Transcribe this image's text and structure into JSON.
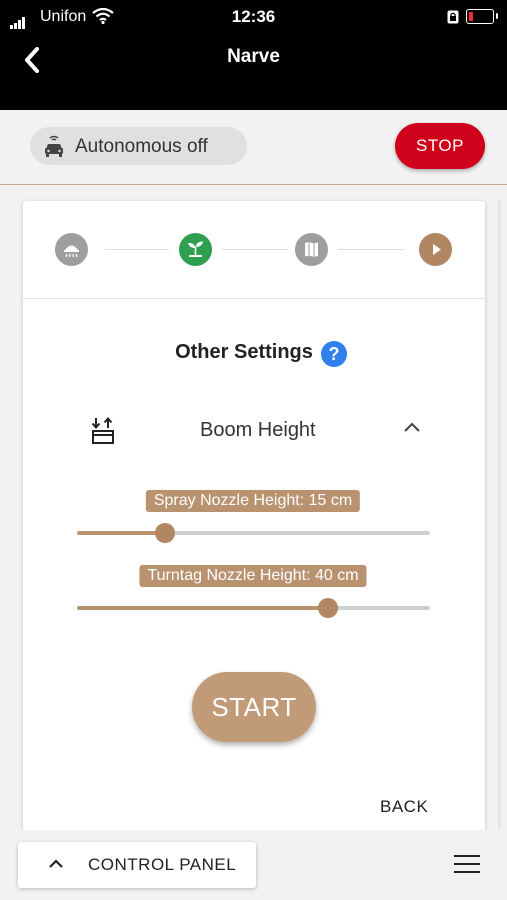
{
  "status_bar": {
    "carrier": "Unifon",
    "time": "12:36"
  },
  "nav": {
    "title": "Narve"
  },
  "autonomous": {
    "label": "Autonomous off"
  },
  "stop": {
    "label": "STOP"
  },
  "settings": {
    "title": "Other Settings",
    "help_symbol": "?",
    "boom": {
      "label": "Boom Height"
    },
    "spray_slider": {
      "label": "Spray Nozzle Height: 15 cm",
      "value_fraction": 0.25
    },
    "turntag_slider": {
      "label": "Turntag Nozzle Height: 40 cm",
      "value_fraction": 0.71
    }
  },
  "start": {
    "label": "START"
  },
  "back": {
    "label": "BACK"
  },
  "control_panel": {
    "label": "CONTROL PANEL"
  },
  "colors": {
    "accent": "#b99270",
    "stop": "#d0021b",
    "active_step": "#2e9e4f",
    "help": "#2f80ed"
  },
  "steps": [
    {
      "icon": "sprinkler-icon",
      "state": "inactive"
    },
    {
      "icon": "plant-icon",
      "state": "active"
    },
    {
      "icon": "map-icon",
      "state": "inactive"
    },
    {
      "icon": "play-icon",
      "state": "current"
    }
  ]
}
